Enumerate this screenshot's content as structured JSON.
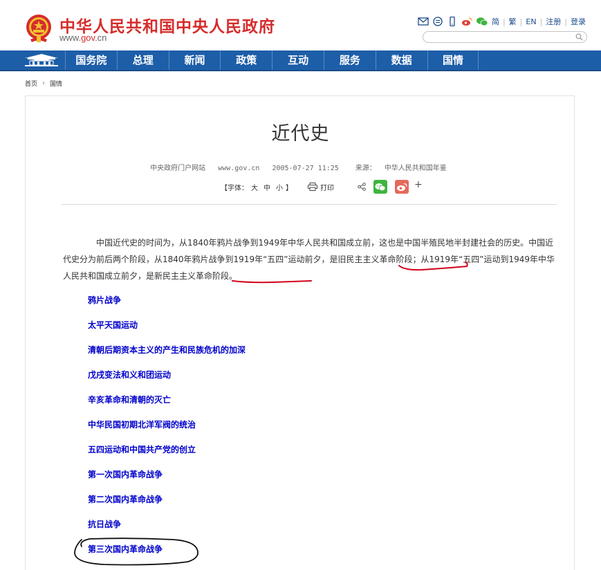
{
  "header": {
    "site_title": "中华人民共和国中央人民政府",
    "site_url_prefix": "www.",
    "site_url_domain": "gov",
    "site_url_suffix": ".cn",
    "top_links": [
      "简",
      "繁",
      "EN",
      "注册",
      "登录"
    ],
    "search_placeholder": ""
  },
  "nav": {
    "items": [
      "国务院",
      "总理",
      "新闻",
      "政策",
      "互动",
      "服务",
      "数据",
      "国情"
    ]
  },
  "breadcrumb": [
    "首页",
    "国情"
  ],
  "article": {
    "title": "近代史",
    "meta_source_site": "中央政府门户网站",
    "meta_url": "www.gov.cn",
    "meta_datetime": "2005-07-27 11:25",
    "meta_source_label": "来源：",
    "meta_source": "中华人民共和国年鉴",
    "font_label_open": "【字体：",
    "font_sizes": [
      "大",
      "中",
      "小"
    ],
    "font_label_close": "】",
    "print_label": "打印",
    "paragraph_part1": "中国近代史的时间为，从1840年鸦片战争到1949年中华人民共和国成立前，这也是中国半殖民地半封建社会的历史。中国近代史分为前后两个阶段，从1840年鸦片战争到1919年“五四”运动前夕，是旧",
    "paragraph_highlight1": "民主主义革命阶段",
    "paragraph_part2": "；从1919年“五四”运动到1949年中华人民共和国成立前夕，是",
    "paragraph_highlight2": "新民主主义革命阶段",
    "paragraph_part3": "。",
    "topics": [
      "鸦片战争",
      "太平天国运动",
      "清朝后期资本主义的产生和民族危机的加深",
      "戊戌变法和义和团运动",
      "辛亥革命和清朝的灭亡",
      "中华民国初期北洋军阀的统治",
      "五四运动和中国共产党的创立",
      "第一次国内革命战争",
      "第二次国内革命战争",
      "抗日战争",
      "第三次国内革命战争"
    ]
  },
  "colors": {
    "brand_red": "#d62c2c",
    "nav_blue": "#1d5ea8",
    "link_blue": "#0000cc",
    "annotation_red": "#d0021b"
  }
}
